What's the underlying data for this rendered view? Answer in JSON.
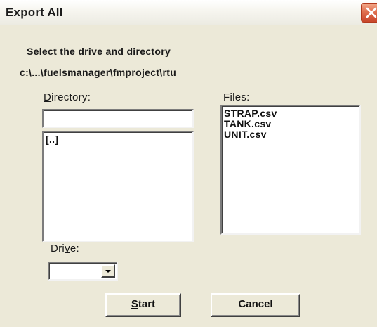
{
  "dialog": {
    "title": "Export All"
  },
  "instruction": "Select the drive and directory",
  "current_path": "c:\\...\\fuelsmanager\\fmproject\\rtu",
  "directory": {
    "label_prefix": "",
    "label_mnemonic": "D",
    "label_rest": "irectory:",
    "input_value": "",
    "items": [
      "[..]"
    ]
  },
  "files": {
    "label": "Files:",
    "items": [
      "STRAP.csv",
      "TANK.csv",
      "UNIT.csv"
    ]
  },
  "drive": {
    "label_prefix": "Dri",
    "label_mnemonic": "v",
    "label_rest": "e:",
    "selected": ""
  },
  "buttons": {
    "start_mnemonic": "S",
    "start_rest": "tart",
    "cancel_label": "Cancel"
  },
  "icons": {
    "close": "close-x-icon",
    "dropdown": "chevron-down-icon"
  },
  "colors": {
    "dialog_bg": "#ece9d8",
    "close_button": "#e07050"
  }
}
